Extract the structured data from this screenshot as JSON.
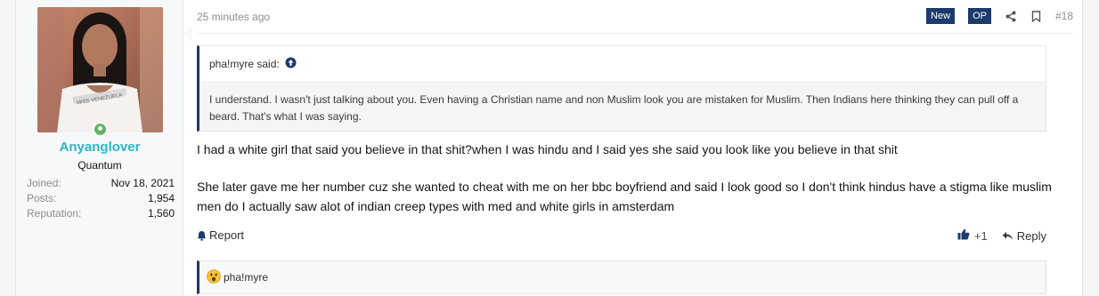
{
  "user": {
    "name": "Anyanglover",
    "title": "Quantum",
    "stats": [
      {
        "label": "Joined:",
        "value": "Nov 18, 2021"
      },
      {
        "label": "Posts:",
        "value": "1,954"
      },
      {
        "label": "Reputation:",
        "value": "1,560"
      }
    ],
    "avatar_sash_text": "MISS VENEZUELA",
    "online": true
  },
  "post": {
    "timestamp": "25 minutes ago",
    "badges": [
      "New",
      "OP"
    ],
    "number": "#18"
  },
  "quote": {
    "author": "pha!myre said:",
    "text": "I understand. I wasn't just talking about you. Even having a Christian name and non Muslim look you are mistaken for Muslim. Then Indians here thinking they can pull off a beard. That's what I was saying."
  },
  "message": {
    "paragraphs": [
      "I had a white girl that said you believe in that shit?when I was hindu and I said yes she said you look like you believe in that shit",
      "She later gave me her number cuz she wanted to cheat with me on her bbc boyfriend and said I look good so I don't think hindus have a stigma like muslim men do I actually saw alot of indian creep types with med and white girls in amsterdam"
    ]
  },
  "footer": {
    "report": "Report",
    "like_count": "+1",
    "reply": "Reply"
  },
  "reactions": {
    "users": "pha!myre"
  },
  "colors": {
    "badge": "#1c3a6b",
    "username": "#2bb6c9",
    "online": "#63b265"
  },
  "icons": [
    "share-icon",
    "bookmark-icon",
    "arrow-up-icon",
    "bell-icon",
    "thumbs-up-icon",
    "reply-icon",
    "surprised-emoji-icon"
  ]
}
